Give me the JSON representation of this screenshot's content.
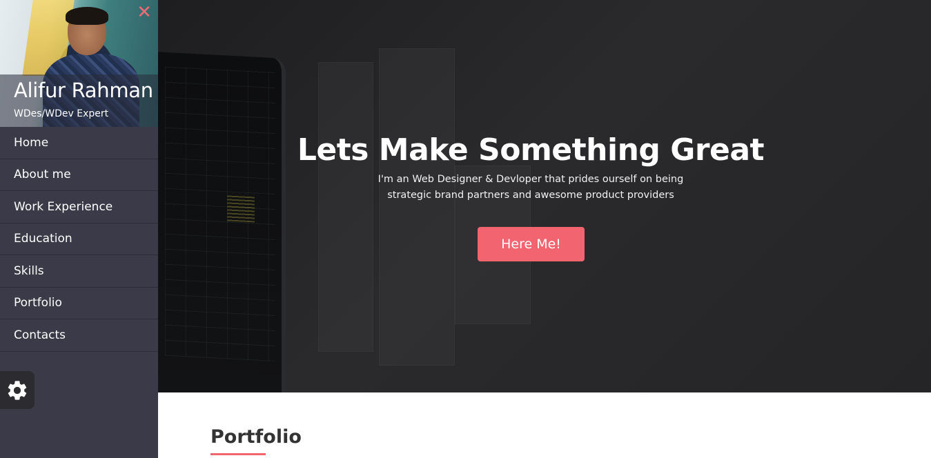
{
  "sidebar": {
    "profile": {
      "name": "Alifur Rahman",
      "role": "WDes/WDev Expert",
      "close_icon": "close-icon"
    },
    "nav_items": [
      {
        "label": "Home"
      },
      {
        "label": "About me"
      },
      {
        "label": "Work Experience"
      },
      {
        "label": "Education"
      },
      {
        "label": "Skills"
      },
      {
        "label": "Portfolio"
      },
      {
        "label": "Contacts"
      }
    ],
    "settings_icon": "gear-icon"
  },
  "hero": {
    "title": "Lets Make Something Great",
    "subtitle_line1": "I'm an Web Designer & Devloper that prides ourself on being",
    "subtitle_line2": "strategic brand partners and awesome product providers",
    "button_label": "Here Me!"
  },
  "portfolio_section": {
    "title": "Portfolio"
  },
  "colors": {
    "accent": "#f2646f",
    "sidebar_bg": "#3a3a48",
    "hero_bg": "#252527"
  }
}
